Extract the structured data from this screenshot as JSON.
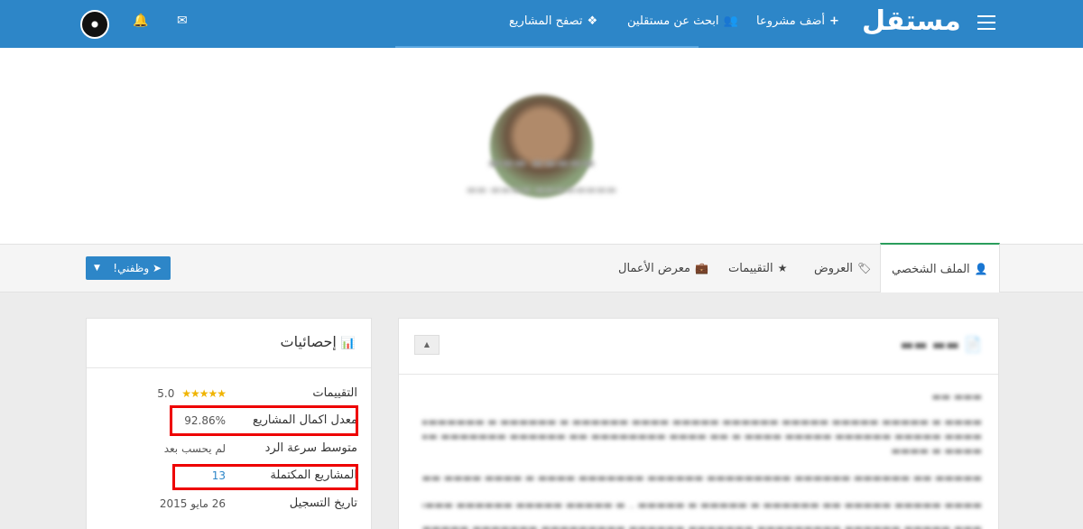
{
  "navbar": {
    "brand": "مستقل",
    "links": {
      "add_project": "أضف مشروعا",
      "find_freelancers": "ابحث عن مستقلين",
      "browse_projects": "تصفح المشاريع"
    }
  },
  "tabs": {
    "profile": "الملف الشخصي",
    "offers": "العروض",
    "ratings": "التقييمات",
    "portfolio": "معرض الأعمال"
  },
  "notify_button": "وظفني!",
  "stats": {
    "title": "إحصائيات",
    "rows": [
      {
        "label": "التقييمات",
        "value": "5.0"
      },
      {
        "label": "معدل اكمال المشاريع",
        "value": "92.86%"
      },
      {
        "label": "متوسط سرعة الرد",
        "value": "لم يحسب بعد"
      },
      {
        "label": "المشاريع المكتملة",
        "value": "13"
      },
      {
        "label": "تاريخ التسجيل",
        "value": "26 مايو 2015"
      }
    ]
  },
  "colors": {
    "navbar": "#2d86c8",
    "active_tab_border": "#2a9d5c",
    "highlight": "#e00000",
    "stars": "#f0b400"
  }
}
